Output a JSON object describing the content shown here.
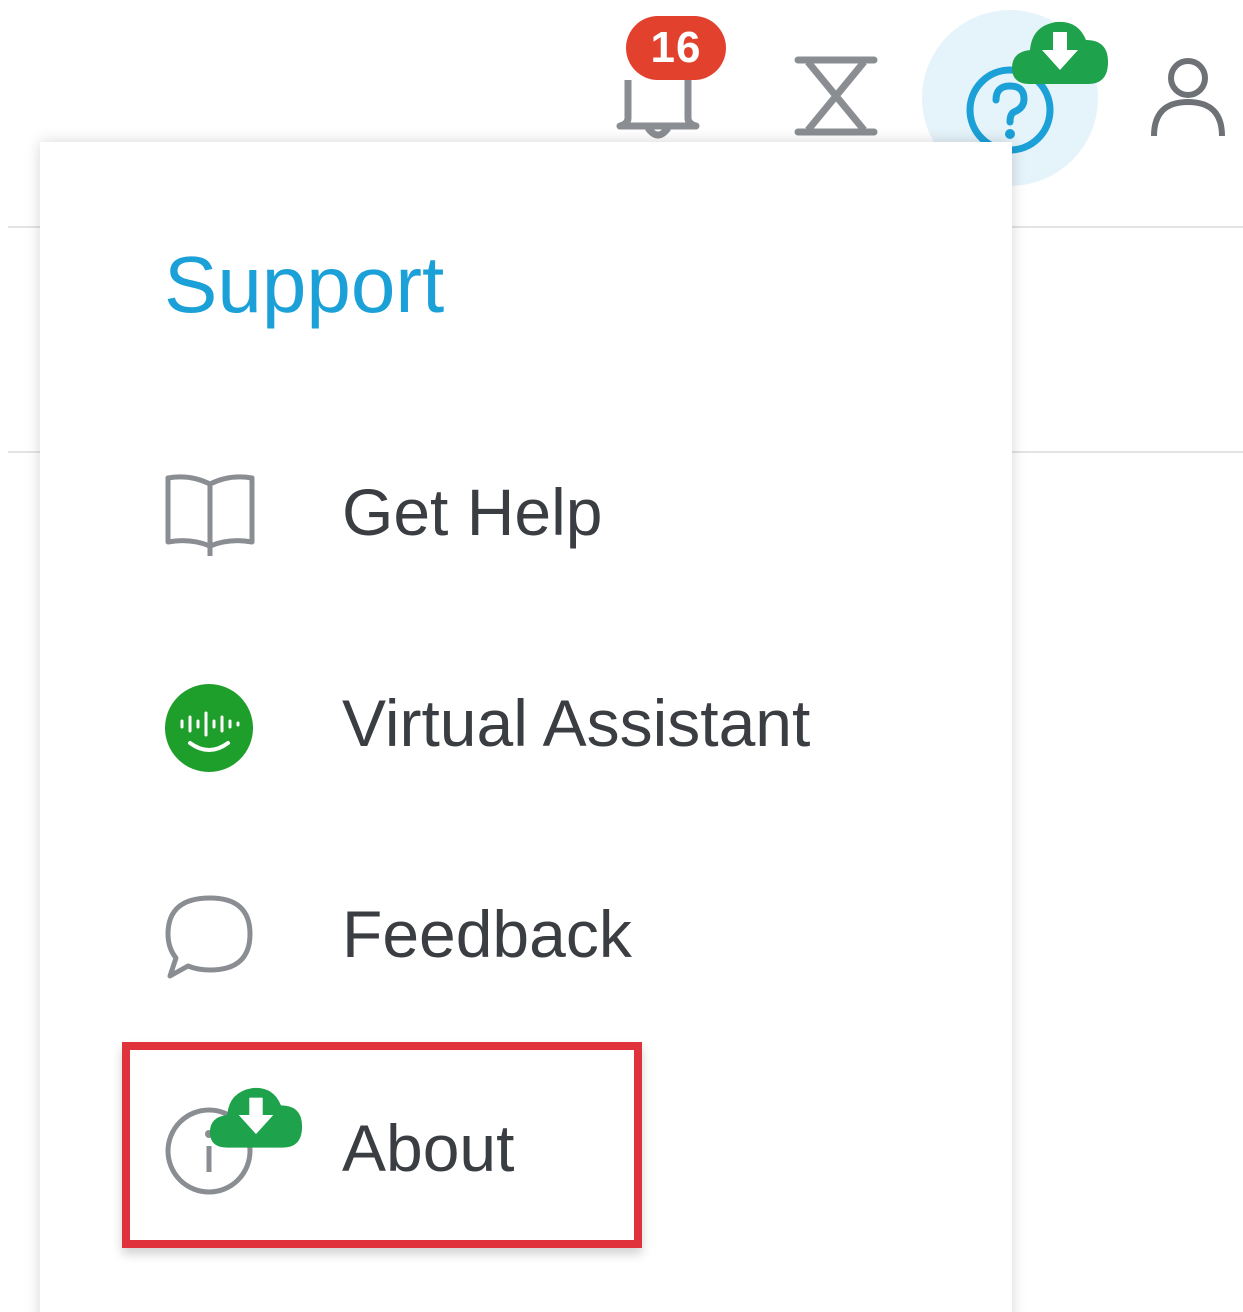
{
  "toolbar": {
    "notifications": {
      "icon": "bell-icon",
      "badge_count": "16",
      "badge_color": "#e2412e"
    },
    "tasks": {
      "icon": "hourglass-icon"
    },
    "help": {
      "icon": "help-question-icon",
      "update_icon": "cloud-download-icon",
      "accent": "#1ba0d7",
      "update_color": "#1ea24b"
    },
    "user": {
      "icon": "user-icon"
    }
  },
  "support_menu": {
    "title": "Support",
    "title_color": "#1ba0d7",
    "items": [
      {
        "label": "Get Help",
        "icon": "book-icon"
      },
      {
        "label": "Virtual Assistant",
        "icon": "virtual-assistant-icon",
        "icon_color": "#1e9e2a"
      },
      {
        "label": "Feedback",
        "icon": "speech-bubble-icon"
      },
      {
        "label": "About",
        "icon": "info-icon",
        "update_icon": "cloud-download-icon",
        "highlighted": true,
        "highlight_color": "#e0323a"
      }
    ]
  }
}
